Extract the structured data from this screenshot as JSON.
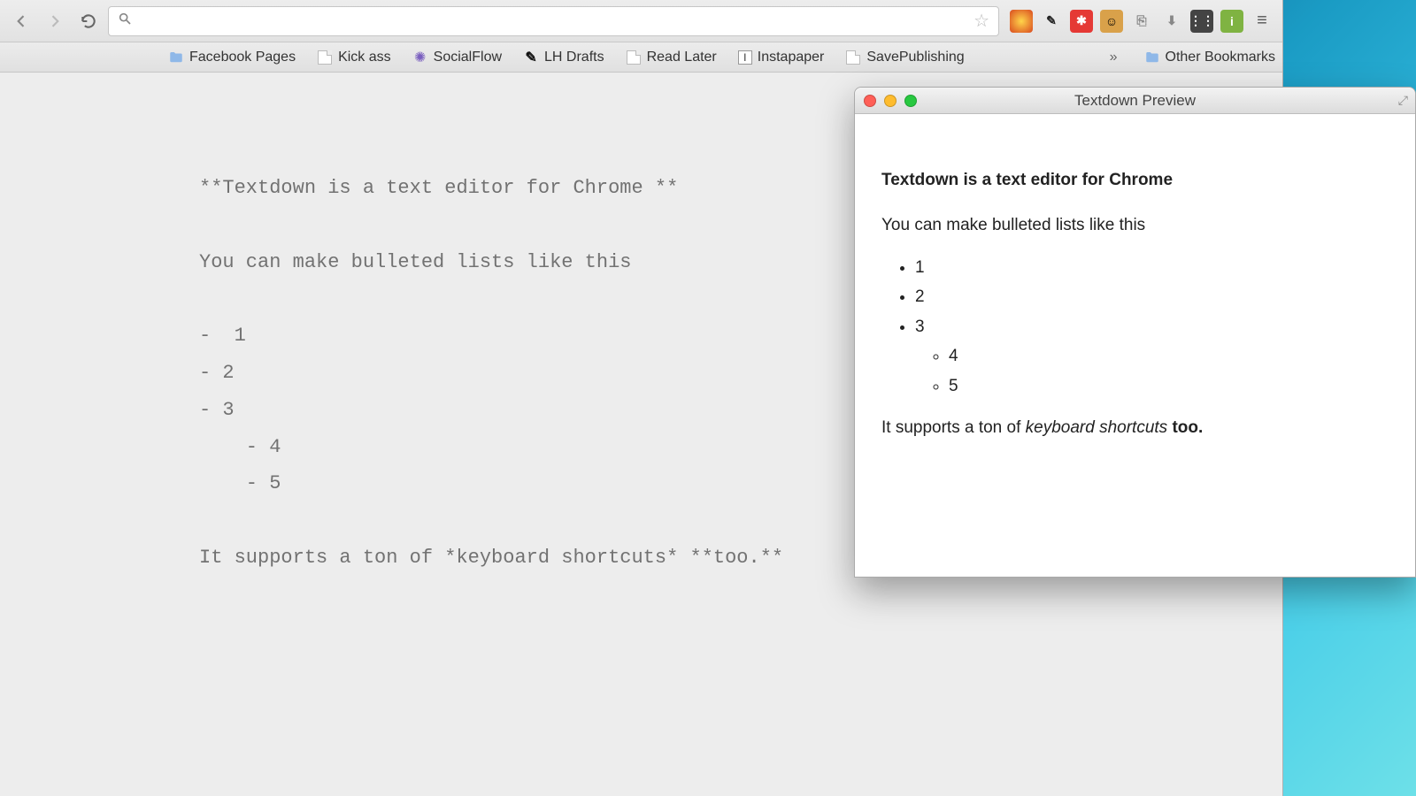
{
  "toolbar": {
    "omnibox_value": "",
    "omnibox_placeholder": ""
  },
  "bookmarks": {
    "items": [
      {
        "label": "Facebook Pages",
        "type": "folder"
      },
      {
        "label": "Kick ass",
        "type": "page"
      },
      {
        "label": "SocialFlow",
        "type": "custom"
      },
      {
        "label": "LH Drafts",
        "type": "custom-dark"
      },
      {
        "label": "Read Later",
        "type": "page"
      },
      {
        "label": "Instapaper",
        "type": "custom-i"
      },
      {
        "label": "SavePublishing",
        "type": "page"
      }
    ],
    "overflow": "»",
    "other": "Other Bookmarks"
  },
  "editor": {
    "line1": "**Textdown is a text editor for Chrome **",
    "line2": "You can make bulleted lists like this",
    "line3": "-  1",
    "line4": "- 2",
    "line5": "- 3",
    "line6": "    - 4",
    "line7": "    - 5",
    "line8": "It supports a ton of *keyboard shortcuts* **too.**"
  },
  "preview": {
    "title": "Textdown Preview",
    "heading": "Textdown is a text editor for Chrome",
    "para1": "You can make bulleted lists like this",
    "list": {
      "i1": "1",
      "i2": "2",
      "i3": "3",
      "sub1": "4",
      "sub2": "5"
    },
    "para2_a": "It supports a ton of ",
    "para2_b": "keyboard shortcuts",
    "para2_c": " too."
  }
}
